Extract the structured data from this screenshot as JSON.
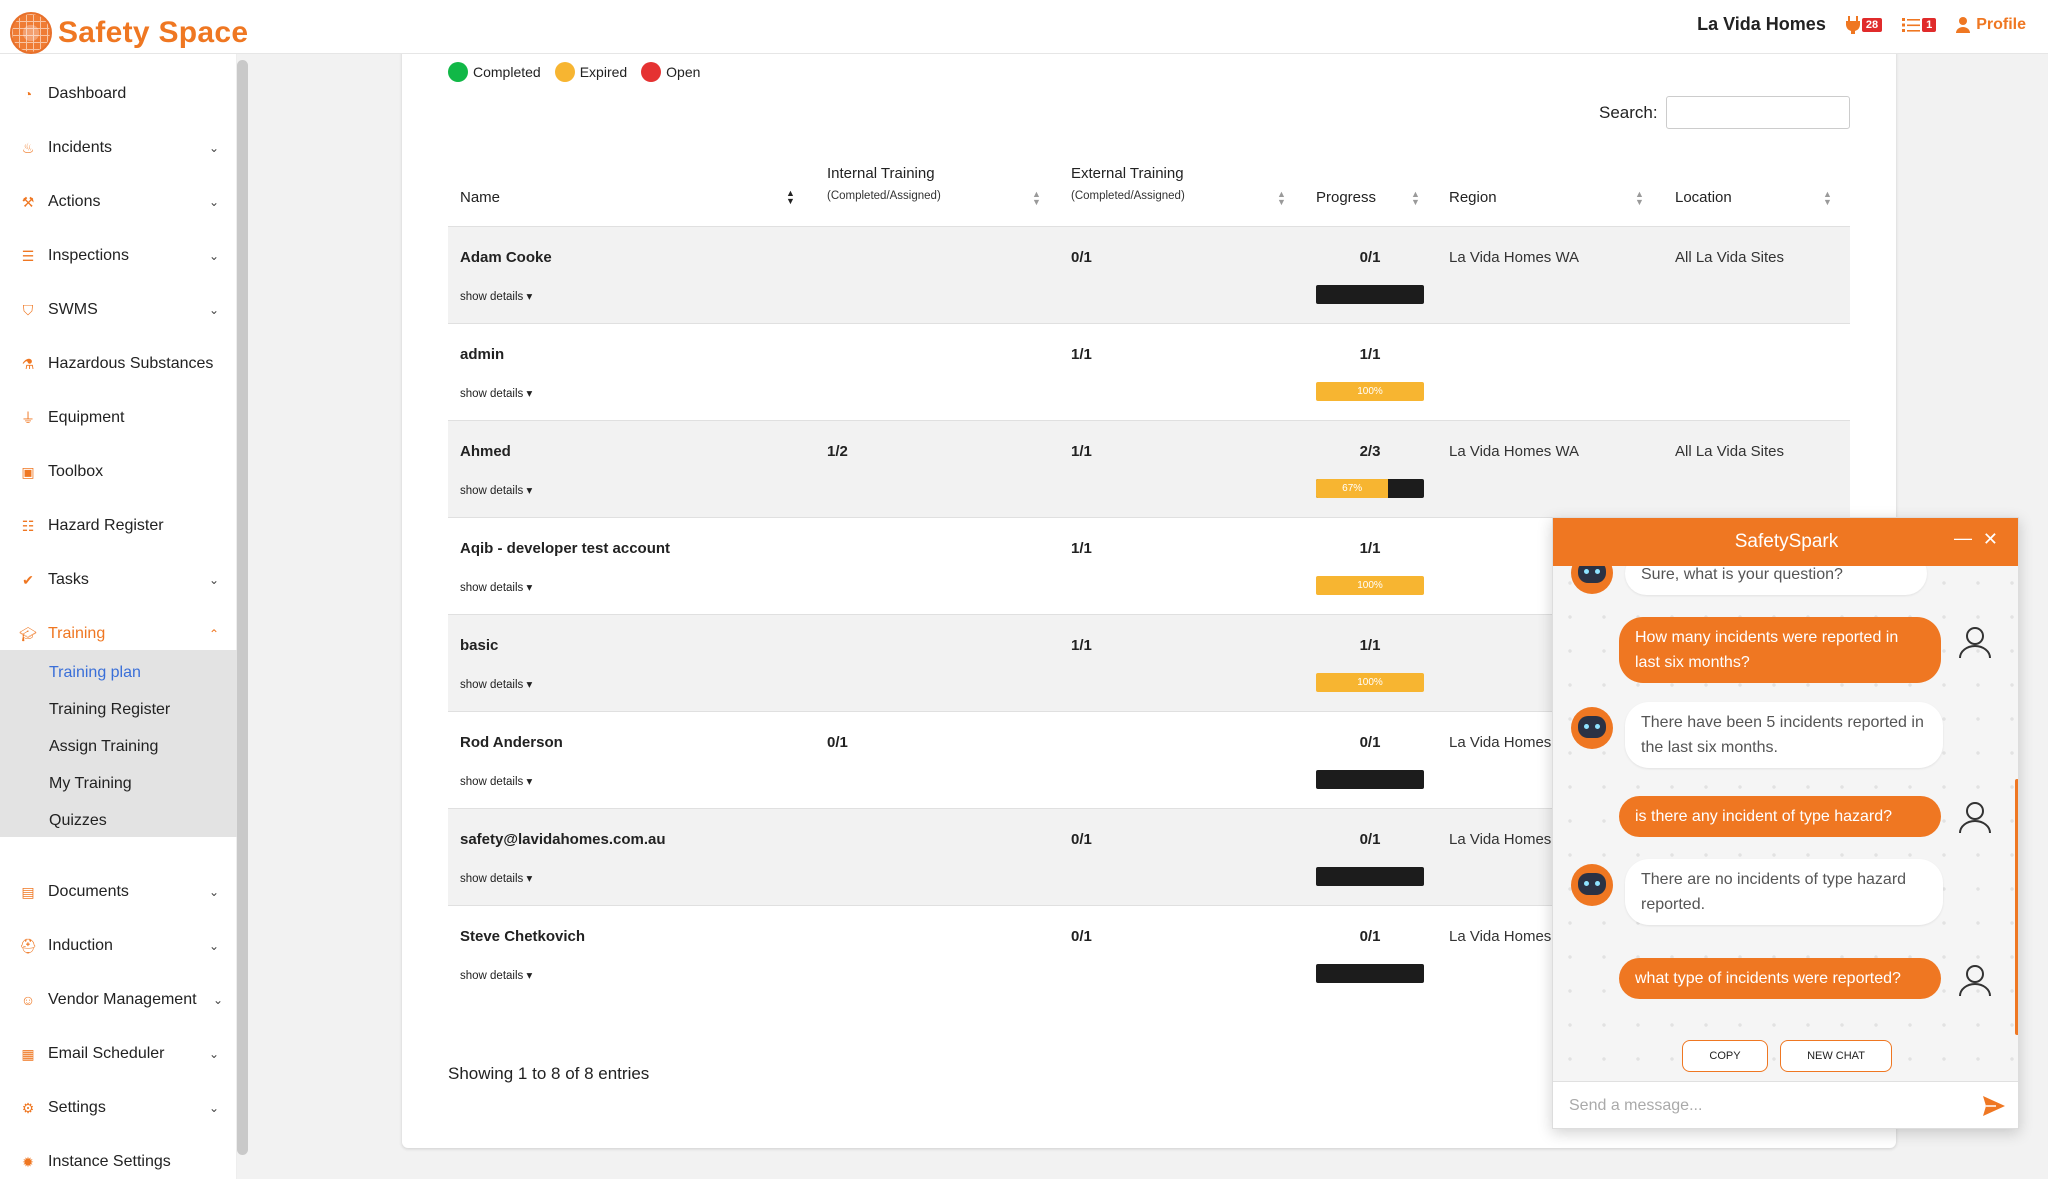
{
  "app": {
    "name": "Safety Space"
  },
  "header": {
    "org": "La Vida Homes",
    "alerts_count": "28",
    "tasks_count": "1",
    "profile_label": "Profile"
  },
  "sidebar": {
    "items": [
      {
        "label": "Dashboard",
        "icon": "dashboard-icon",
        "chevron": false
      },
      {
        "label": "Incidents",
        "icon": "fire-icon",
        "chevron": true
      },
      {
        "label": "Actions",
        "icon": "hammer-icon",
        "chevron": true
      },
      {
        "label": "Inspections",
        "icon": "list-icon",
        "chevron": true
      },
      {
        "label": "SWMS",
        "icon": "shield-icon",
        "chevron": true
      },
      {
        "label": "Hazardous Substances",
        "icon": "flask-icon",
        "chevron": false
      },
      {
        "label": "Equipment",
        "icon": "plug-icon",
        "chevron": false
      },
      {
        "label": "Toolbox",
        "icon": "toolbox-icon",
        "chevron": false
      },
      {
        "label": "Hazard Register",
        "icon": "table-icon",
        "chevron": false
      },
      {
        "label": "Tasks",
        "icon": "check-icon",
        "chevron": true
      },
      {
        "label": "Training",
        "icon": "graduation-cap-icon",
        "chevron": true,
        "active": true
      }
    ],
    "training_sub": [
      "Training plan",
      "Training Register",
      "Assign Training",
      "My Training",
      "Quizzes"
    ],
    "items_after": [
      {
        "label": "Documents",
        "icon": "document-icon",
        "chevron": true
      },
      {
        "label": "Induction",
        "icon": "hard-hat-icon",
        "chevron": true
      },
      {
        "label": "Vendor Management",
        "icon": "users-icon",
        "chevron": true
      },
      {
        "label": "Email Scheduler",
        "icon": "calendar-icon",
        "chevron": true
      },
      {
        "label": "Settings",
        "icon": "gears-icon",
        "chevron": true
      },
      {
        "label": "Instance Settings",
        "icon": "gear-icon",
        "chevron": false
      }
    ]
  },
  "legend": [
    {
      "label": "Completed",
      "color": "#11b847"
    },
    {
      "label": "Expired",
      "color": "#f7b531"
    },
    {
      "label": "Open",
      "color": "#e53232"
    }
  ],
  "search": {
    "label": "Search:",
    "value": ""
  },
  "table": {
    "columns": {
      "name": "Name",
      "internal": "Internal Training",
      "internal_sub": "(Completed/Assigned)",
      "external": "External Training",
      "external_sub": "(Completed/Assigned)",
      "progress": "Progress",
      "region": "Region",
      "location": "Location"
    },
    "show_details": "show details",
    "rows": [
      {
        "name": "Adam Cooke",
        "internal": "",
        "external": "0/1",
        "progress": "0/1",
        "pct": 0,
        "pct_label": "",
        "region": "La Vida Homes WA",
        "location": "All La Vida Sites"
      },
      {
        "name": "admin",
        "internal": "",
        "external": "1/1",
        "progress": "1/1",
        "pct": 100,
        "pct_label": "100%",
        "region": "",
        "location": ""
      },
      {
        "name": "Ahmed",
        "internal": "1/2",
        "external": "1/1",
        "progress": "2/3",
        "pct": 67,
        "pct_label": "67%",
        "region": "La Vida Homes WA",
        "location": "All La Vida Sites"
      },
      {
        "name": "Aqib - developer test account",
        "internal": "",
        "external": "1/1",
        "progress": "1/1",
        "pct": 100,
        "pct_label": "100%",
        "region": "",
        "location": ""
      },
      {
        "name": "basic",
        "internal": "",
        "external": "1/1",
        "progress": "1/1",
        "pct": 100,
        "pct_label": "100%",
        "region": "",
        "location": ""
      },
      {
        "name": "Rod Anderson",
        "internal": "0/1",
        "external": "",
        "progress": "0/1",
        "pct": 0,
        "pct_label": "",
        "region": "La Vida Homes",
        "location": ""
      },
      {
        "name": "safety@lavidahomes.com.au",
        "internal": "",
        "external": "0/1",
        "progress": "0/1",
        "pct": 0,
        "pct_label": "",
        "region": "La Vida Homes",
        "location": ""
      },
      {
        "name": "Steve Chetkovich",
        "internal": "",
        "external": "0/1",
        "progress": "0/1",
        "pct": 0,
        "pct_label": "",
        "region": "La Vida Homes",
        "location": ""
      }
    ],
    "info": "Showing 1 to 8 of 8 entries"
  },
  "chat": {
    "title": "SafetySpark",
    "messages": [
      {
        "from": "bot",
        "text": "Sure, what is your question?"
      },
      {
        "from": "user",
        "text": "How many incidents were reported in last six months?"
      },
      {
        "from": "bot",
        "text": "There have been 5 incidents reported in the last six months."
      },
      {
        "from": "user",
        "text": "is there any incident of type hazard?"
      },
      {
        "from": "bot",
        "text": "There are no incidents of type hazard reported."
      },
      {
        "from": "user",
        "text": "what type of incidents were reported?"
      }
    ],
    "copy_label": "COPY",
    "new_chat_label": "NEW CHAT",
    "input_placeholder": "Send a message...",
    "accent": "#ef7722"
  }
}
